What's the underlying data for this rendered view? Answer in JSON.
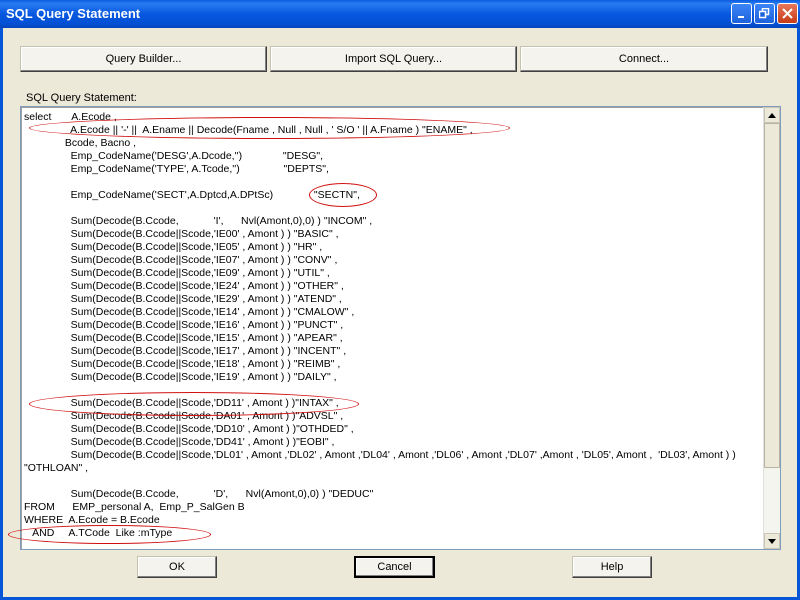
{
  "window": {
    "title": "SQL Query Statement",
    "controls": {
      "minimize": "minimize",
      "restore": "restore",
      "close": "close"
    }
  },
  "toolbar": {
    "query_builder": "Query Builder...",
    "import_sql": "Import SQL Query...",
    "connect": "Connect..."
  },
  "editor": {
    "label": "SQL Query Statement:",
    "lines": [
      "select       A.Ecode ,",
      "                A.Ecode || '-' ||  A.Ename || Decode(Fname , Null , Null , ' S/O ' || A.Fname ) \"ENAME\" ,",
      "              Bcode, Bacno ,",
      "                Emp_CodeName('DESG',A.Dcode,'')              \"DESG\",",
      "                Emp_CodeName('TYPE', A.Tcode,'')               \"DEPTS\",",
      "",
      "                Emp_CodeName('SECT',A.Dptcd,A.DPtSc)              \"SECTN\",",
      "",
      "                Sum(Decode(B.Ccode,            'I',      Nvl(Amont,0),0) ) \"INCOM\" ,",
      "                Sum(Decode(B.Ccode||Scode,'IE00' , Amont ) ) \"BASIC\" ,",
      "                Sum(Decode(B.Ccode||Scode,'IE05' , Amont ) ) \"HR\" ,",
      "                Sum(Decode(B.Ccode||Scode,'IE07' , Amont ) ) \"CONV\" ,",
      "                Sum(Decode(B.Ccode||Scode,'IE09' , Amont ) ) \"UTIL\" ,",
      "                Sum(Decode(B.Ccode||Scode,'IE24' , Amont ) ) \"OTHER\" ,",
      "                Sum(Decode(B.Ccode||Scode,'IE29' , Amont ) ) \"ATEND\" ,",
      "                Sum(Decode(B.Ccode||Scode,'IE14' , Amont ) ) \"CMALOW\" ,",
      "                Sum(Decode(B.Ccode||Scode,'IE16' , Amont ) ) \"PUNCT\" ,",
      "                Sum(Decode(B.Ccode||Scode,'IE15' , Amont ) ) \"APEAR\" ,",
      "                Sum(Decode(B.Ccode||Scode,'IE17' , Amont ) ) \"INCENT\" ,",
      "                Sum(Decode(B.Ccode||Scode,'IE18' , Amont ) ) \"REIMB\" ,",
      "                Sum(Decode(B.Ccode||Scode,'IE19' , Amont ) ) \"DAILY\" ,",
      "",
      "                Sum(Decode(B.Ccode||Scode,'DD11' , Amont ) )\"INTAX\" ,",
      "                Sum(Decode(B.Ccode||Scode,'DA01' , Amont ) )\"ADVSL\" ,",
      "                Sum(Decode(B.Ccode||Scode,'DD10' , Amont ) )\"OTHDED\" ,",
      "                Sum(Decode(B.Ccode||Scode,'DD41' , Amont ) )\"EOBI\" ,",
      "                Sum(Decode(B.Ccode||Scode,'DL01' , Amont ,'DL02' , Amont ,'DL04' , Amont ,'DL06' , Amont ,'DL07' ,Amont , 'DL05', Amont ,  'DL03', Amont ) )",
      "\"OTHLOAN\" ,",
      "",
      "                Sum(Decode(B.Ccode,            'D',      Nvl(Amont,0),0) ) \"DEDUC\"",
      "FROM      EMP_personal A,  Emp_P_SalGen B",
      "WHERE  A.Ecode = B.Ecode",
      "   AND     A.TCode  Like :mType"
    ]
  },
  "footer": {
    "ok": "OK",
    "cancel": "Cancel",
    "help": "Help"
  },
  "annotation_color": "#d01010"
}
